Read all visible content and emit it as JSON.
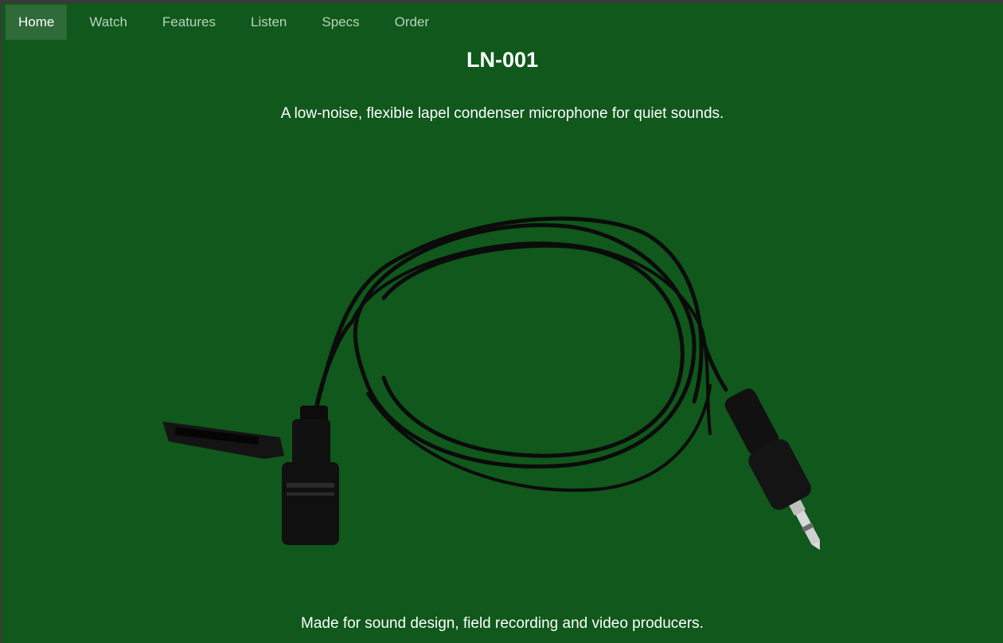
{
  "nav": {
    "items": [
      {
        "label": "Home",
        "active": true
      },
      {
        "label": "Watch"
      },
      {
        "label": "Features"
      },
      {
        "label": "Listen"
      },
      {
        "label": "Specs"
      },
      {
        "label": "Order"
      }
    ]
  },
  "hero": {
    "title": "LN-001",
    "tagline": "A low-noise, flexible lapel condenser microphone for quiet sounds.",
    "footer": "Made for sound design, field recording and video producers."
  },
  "colors": {
    "background": "#10581b",
    "nav_active": "#2f6a39",
    "text": "#ffffff"
  }
}
